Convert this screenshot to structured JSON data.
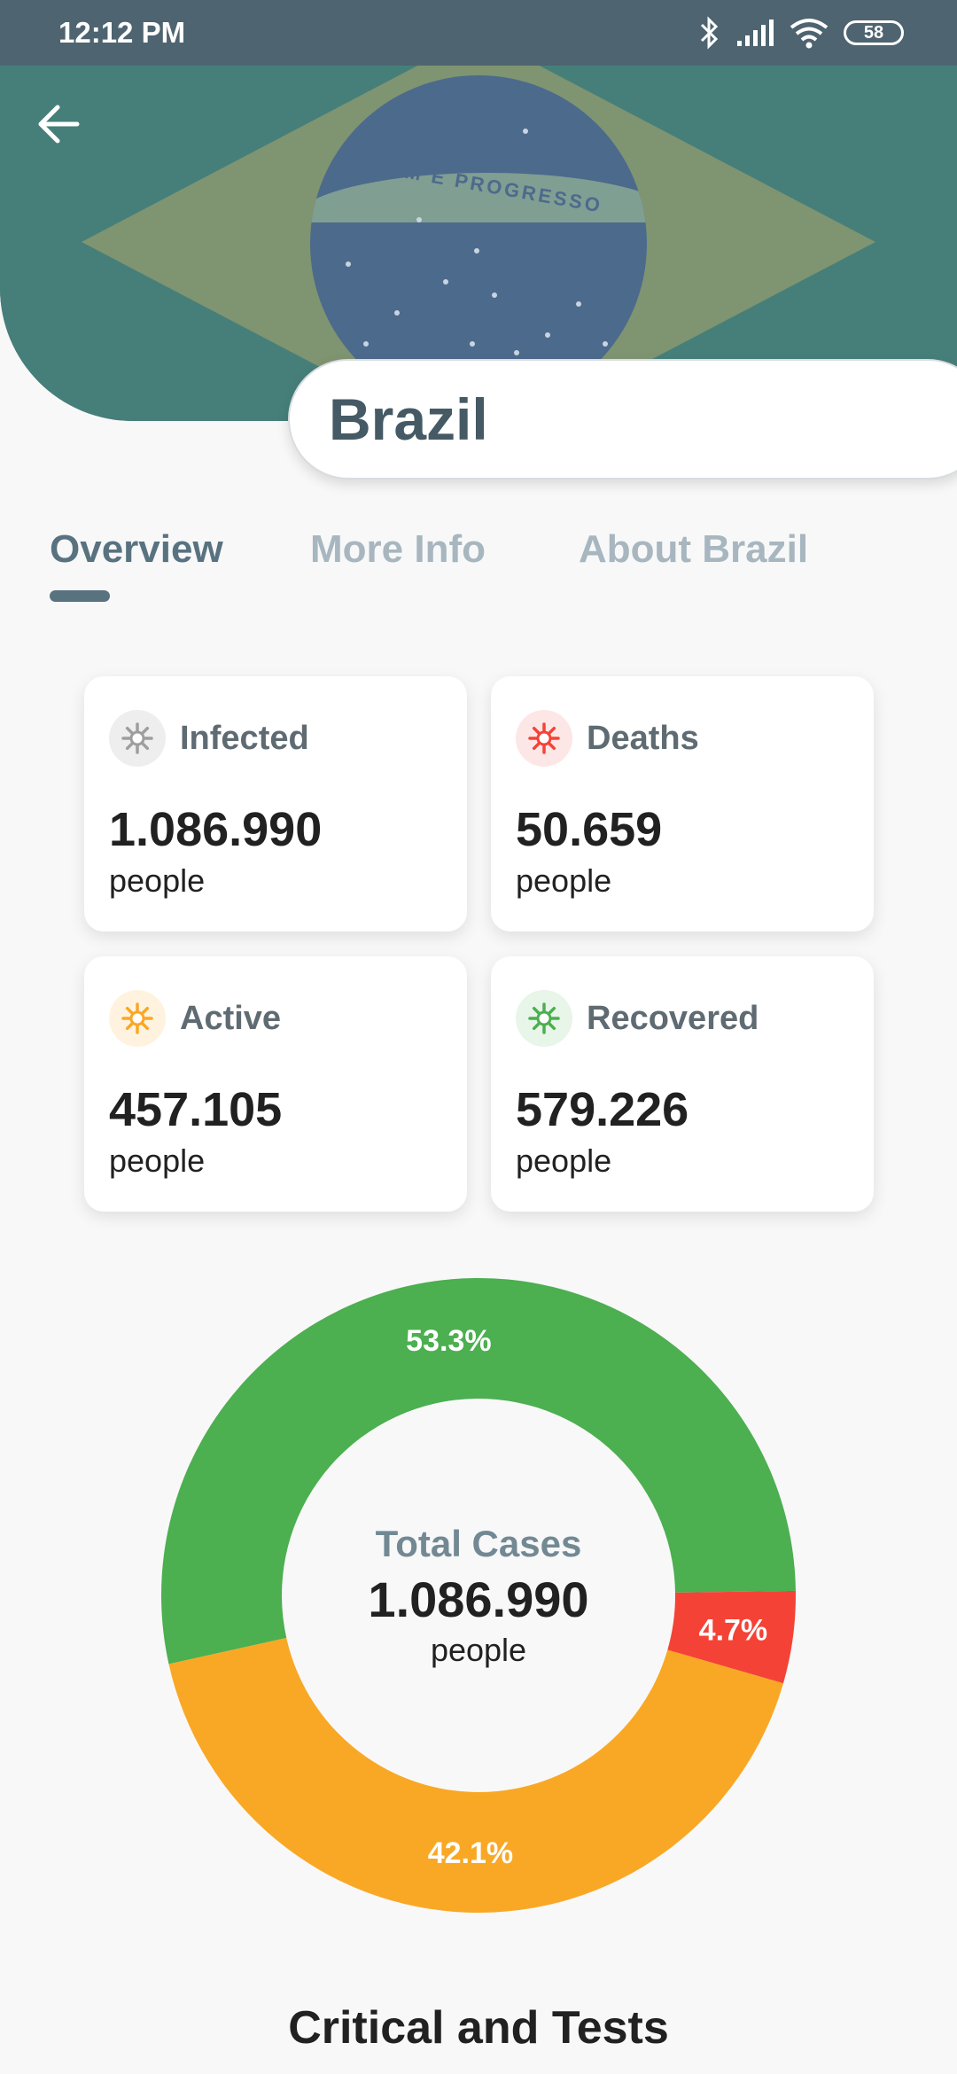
{
  "status_bar": {
    "time": "12:12 PM",
    "battery": "58"
  },
  "header": {
    "country": "Brazil",
    "flag_motto": "ORDEM E PROGRESSO"
  },
  "tabs": [
    {
      "label": "Overview",
      "active": true
    },
    {
      "label": "More Info",
      "active": false
    },
    {
      "label": "About Brazil",
      "active": false
    }
  ],
  "cards": [
    {
      "title": "Infected",
      "value": "1.086.990",
      "unit": "people",
      "color": "#9e9e9e",
      "bg": "#eeeeee",
      "icon": "virus-icon"
    },
    {
      "title": "Deaths",
      "value": "50.659",
      "unit": "people",
      "color": "#f44336",
      "bg": "#fde7e6",
      "icon": "virus-icon"
    },
    {
      "title": "Active",
      "value": "457.105",
      "unit": "people",
      "color": "#f9a825",
      "bg": "#fff3e0",
      "icon": "virus-icon"
    },
    {
      "title": "Recovered",
      "value": "579.226",
      "unit": "people",
      "color": "#4caf50",
      "bg": "#e8f5e9",
      "icon": "virus-icon"
    }
  ],
  "chart_data": {
    "type": "pie",
    "title": "",
    "center_label": "Total Cases",
    "center_value": "1.086.990",
    "center_unit": "people",
    "categories": [
      "Recovered",
      "Deaths",
      "Active"
    ],
    "values": [
      53.3,
      4.7,
      42.1
    ],
    "labels": [
      "53.3%",
      "4.7%",
      "42.1%"
    ],
    "colors": [
      "#4caf50",
      "#f44336",
      "#f9a825"
    ]
  },
  "section": {
    "title": "Critical and Tests"
  }
}
